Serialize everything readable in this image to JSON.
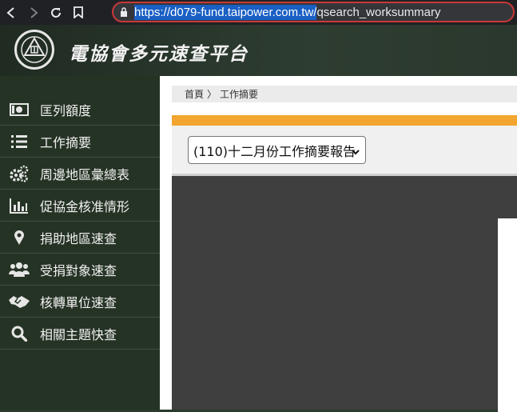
{
  "browser": {
    "url_selected": "https://d079-fund.taipower.com.tw/",
    "url_rest": "qsearch_worksummary",
    "back_icon": "back-icon",
    "forward_icon": "forward-icon",
    "reload_icon": "reload-icon",
    "bookmark_icon": "bookmark-icon"
  },
  "header": {
    "title": "電協會多元速查平台"
  },
  "sidebar": {
    "items": [
      {
        "label": "匡列額度",
        "icon": "money-icon"
      },
      {
        "label": "工作摘要",
        "icon": "list-icon"
      },
      {
        "label": "周邊地區彙總表",
        "icon": "cogs-icon"
      },
      {
        "label": "促協金核准情形",
        "icon": "bar-chart-icon"
      },
      {
        "label": "捐助地區速查",
        "icon": "map-pin-icon"
      },
      {
        "label": "受捐對象速查",
        "icon": "users-icon"
      },
      {
        "label": "核轉單位速查",
        "icon": "handshake-icon"
      },
      {
        "label": "相關主題快查",
        "icon": "search-icon"
      }
    ]
  },
  "breadcrumb": {
    "home": "首頁",
    "separator": "〉",
    "current": "工作摘要"
  },
  "report_select": {
    "value": "(110)十二月份工作摘要報告"
  },
  "colors": {
    "accent": "#f2a52f",
    "sidebar": "#253325",
    "viewer": "#3f3f3f"
  }
}
